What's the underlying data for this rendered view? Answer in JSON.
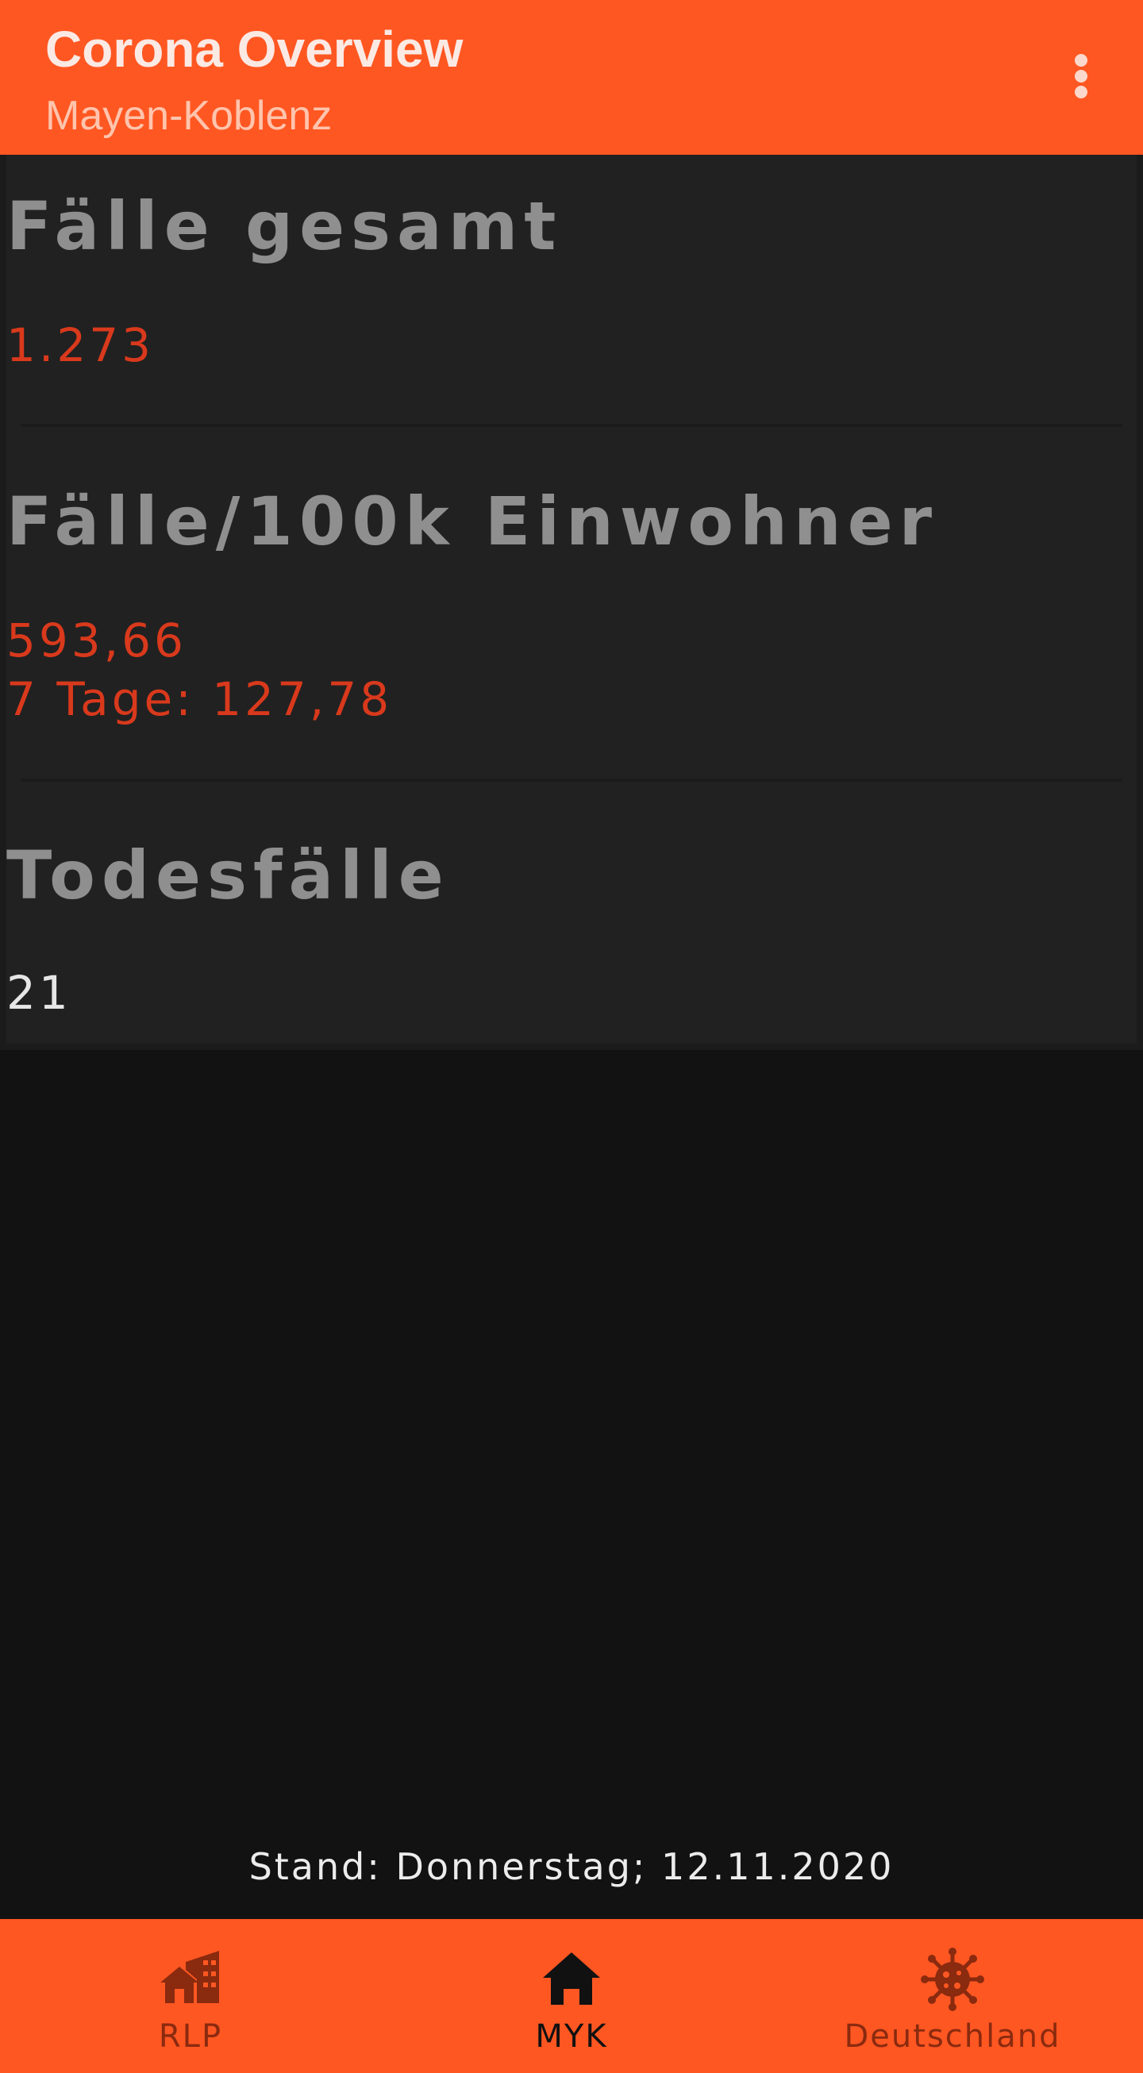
{
  "app_bar": {
    "title": "Corona Overview",
    "subtitle": "Mayen-Koblenz",
    "menu_icon": "more-vert-icon"
  },
  "stats": {
    "cases_total": {
      "title": "Fälle gesamt",
      "value": "1.273"
    },
    "cases_per_100k": {
      "title": "Fälle/100k Einwohner",
      "value": "593,66",
      "seven_day": "7 Tage: 127,78"
    },
    "deaths": {
      "title": "Todesfälle",
      "value": "21"
    }
  },
  "footer": {
    "stand": "Stand: Donnerstag; 12.11.2020"
  },
  "bottom_nav": {
    "items": [
      {
        "label": "RLP",
        "icon": "house-city-icon",
        "active": false
      },
      {
        "label": "MYK",
        "icon": "home-icon",
        "active": true
      },
      {
        "label": "Deutschland",
        "icon": "virus-icon",
        "active": false
      }
    ]
  },
  "colors": {
    "accent": "#ff5722",
    "background": "#121212",
    "card": "#212121",
    "value_red": "#d9391c",
    "title_gray": "#8f8f8f",
    "nav_inactive": "#8a2a0f",
    "nav_active": "#111111"
  }
}
